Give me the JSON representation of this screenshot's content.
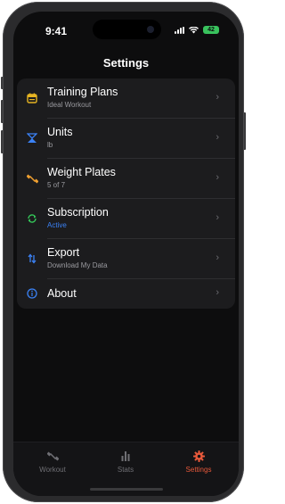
{
  "status_bar": {
    "time": "9:41",
    "battery_level": "42"
  },
  "header": {
    "title": "Settings"
  },
  "settings": {
    "items": [
      {
        "label": "Training Plans",
        "subtitle": "Ideal Workout",
        "icon": "calendar-icon",
        "color": "#e6b422"
      },
      {
        "label": "Units",
        "subtitle": "lb",
        "icon": "scale-icon",
        "color": "#3b82f6"
      },
      {
        "label": "Weight Plates",
        "subtitle": "5 of 7",
        "icon": "dumbbell-icon",
        "color": "#f0a030"
      },
      {
        "label": "Subscription",
        "subtitle": "Active",
        "icon": "refresh-icon",
        "color": "#34c759"
      },
      {
        "label": "Export",
        "subtitle": "Download My Data",
        "icon": "transfer-icon",
        "color": "#3b82f6"
      },
      {
        "label": "About",
        "subtitle": "",
        "icon": "info-icon",
        "color": "#3b82f6"
      }
    ]
  },
  "tabbar": {
    "tabs": [
      {
        "label": "Workout",
        "icon": "dumbbell-icon"
      },
      {
        "label": "Stats",
        "icon": "bar-chart-icon"
      },
      {
        "label": "Settings",
        "icon": "gear-icon"
      }
    ],
    "active_tab": "Settings",
    "active_color": "#e8593b"
  }
}
